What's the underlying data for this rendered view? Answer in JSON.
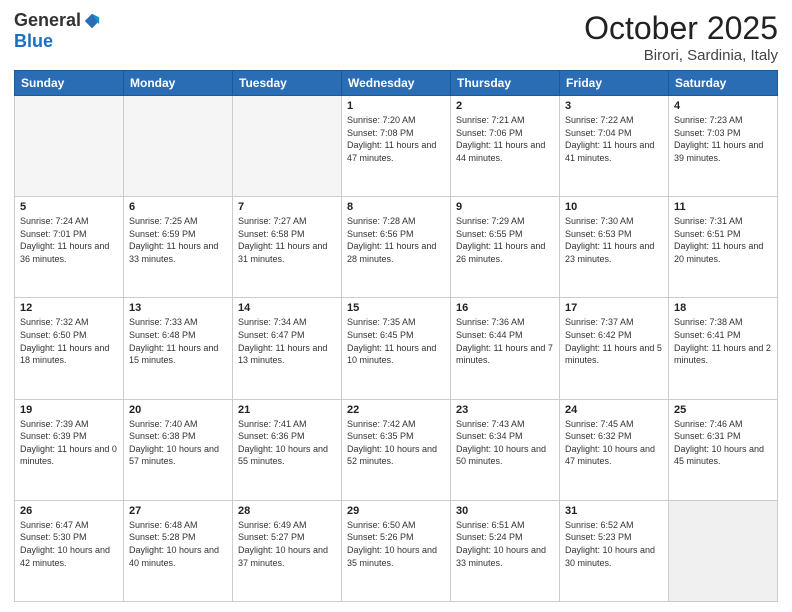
{
  "header": {
    "logo_general": "General",
    "logo_blue": "Blue",
    "month_title": "October 2025",
    "location": "Birori, Sardinia, Italy"
  },
  "weekdays": [
    "Sunday",
    "Monday",
    "Tuesday",
    "Wednesday",
    "Thursday",
    "Friday",
    "Saturday"
  ],
  "weeks": [
    [
      {
        "day": "",
        "info": ""
      },
      {
        "day": "",
        "info": ""
      },
      {
        "day": "",
        "info": ""
      },
      {
        "day": "1",
        "info": "Sunrise: 7:20 AM\nSunset: 7:08 PM\nDaylight: 11 hours and 47 minutes."
      },
      {
        "day": "2",
        "info": "Sunrise: 7:21 AM\nSunset: 7:06 PM\nDaylight: 11 hours and 44 minutes."
      },
      {
        "day": "3",
        "info": "Sunrise: 7:22 AM\nSunset: 7:04 PM\nDaylight: 11 hours and 41 minutes."
      },
      {
        "day": "4",
        "info": "Sunrise: 7:23 AM\nSunset: 7:03 PM\nDaylight: 11 hours and 39 minutes."
      }
    ],
    [
      {
        "day": "5",
        "info": "Sunrise: 7:24 AM\nSunset: 7:01 PM\nDaylight: 11 hours and 36 minutes."
      },
      {
        "day": "6",
        "info": "Sunrise: 7:25 AM\nSunset: 6:59 PM\nDaylight: 11 hours and 33 minutes."
      },
      {
        "day": "7",
        "info": "Sunrise: 7:27 AM\nSunset: 6:58 PM\nDaylight: 11 hours and 31 minutes."
      },
      {
        "day": "8",
        "info": "Sunrise: 7:28 AM\nSunset: 6:56 PM\nDaylight: 11 hours and 28 minutes."
      },
      {
        "day": "9",
        "info": "Sunrise: 7:29 AM\nSunset: 6:55 PM\nDaylight: 11 hours and 26 minutes."
      },
      {
        "day": "10",
        "info": "Sunrise: 7:30 AM\nSunset: 6:53 PM\nDaylight: 11 hours and 23 minutes."
      },
      {
        "day": "11",
        "info": "Sunrise: 7:31 AM\nSunset: 6:51 PM\nDaylight: 11 hours and 20 minutes."
      }
    ],
    [
      {
        "day": "12",
        "info": "Sunrise: 7:32 AM\nSunset: 6:50 PM\nDaylight: 11 hours and 18 minutes."
      },
      {
        "day": "13",
        "info": "Sunrise: 7:33 AM\nSunset: 6:48 PM\nDaylight: 11 hours and 15 minutes."
      },
      {
        "day": "14",
        "info": "Sunrise: 7:34 AM\nSunset: 6:47 PM\nDaylight: 11 hours and 13 minutes."
      },
      {
        "day": "15",
        "info": "Sunrise: 7:35 AM\nSunset: 6:45 PM\nDaylight: 11 hours and 10 minutes."
      },
      {
        "day": "16",
        "info": "Sunrise: 7:36 AM\nSunset: 6:44 PM\nDaylight: 11 hours and 7 minutes."
      },
      {
        "day": "17",
        "info": "Sunrise: 7:37 AM\nSunset: 6:42 PM\nDaylight: 11 hours and 5 minutes."
      },
      {
        "day": "18",
        "info": "Sunrise: 7:38 AM\nSunset: 6:41 PM\nDaylight: 11 hours and 2 minutes."
      }
    ],
    [
      {
        "day": "19",
        "info": "Sunrise: 7:39 AM\nSunset: 6:39 PM\nDaylight: 11 hours and 0 minutes."
      },
      {
        "day": "20",
        "info": "Sunrise: 7:40 AM\nSunset: 6:38 PM\nDaylight: 10 hours and 57 minutes."
      },
      {
        "day": "21",
        "info": "Sunrise: 7:41 AM\nSunset: 6:36 PM\nDaylight: 10 hours and 55 minutes."
      },
      {
        "day": "22",
        "info": "Sunrise: 7:42 AM\nSunset: 6:35 PM\nDaylight: 10 hours and 52 minutes."
      },
      {
        "day": "23",
        "info": "Sunrise: 7:43 AM\nSunset: 6:34 PM\nDaylight: 10 hours and 50 minutes."
      },
      {
        "day": "24",
        "info": "Sunrise: 7:45 AM\nSunset: 6:32 PM\nDaylight: 10 hours and 47 minutes."
      },
      {
        "day": "25",
        "info": "Sunrise: 7:46 AM\nSunset: 6:31 PM\nDaylight: 10 hours and 45 minutes."
      }
    ],
    [
      {
        "day": "26",
        "info": "Sunrise: 6:47 AM\nSunset: 5:30 PM\nDaylight: 10 hours and 42 minutes."
      },
      {
        "day": "27",
        "info": "Sunrise: 6:48 AM\nSunset: 5:28 PM\nDaylight: 10 hours and 40 minutes."
      },
      {
        "day": "28",
        "info": "Sunrise: 6:49 AM\nSunset: 5:27 PM\nDaylight: 10 hours and 37 minutes."
      },
      {
        "day": "29",
        "info": "Sunrise: 6:50 AM\nSunset: 5:26 PM\nDaylight: 10 hours and 35 minutes."
      },
      {
        "day": "30",
        "info": "Sunrise: 6:51 AM\nSunset: 5:24 PM\nDaylight: 10 hours and 33 minutes."
      },
      {
        "day": "31",
        "info": "Sunrise: 6:52 AM\nSunset: 5:23 PM\nDaylight: 10 hours and 30 minutes."
      },
      {
        "day": "",
        "info": ""
      }
    ]
  ]
}
